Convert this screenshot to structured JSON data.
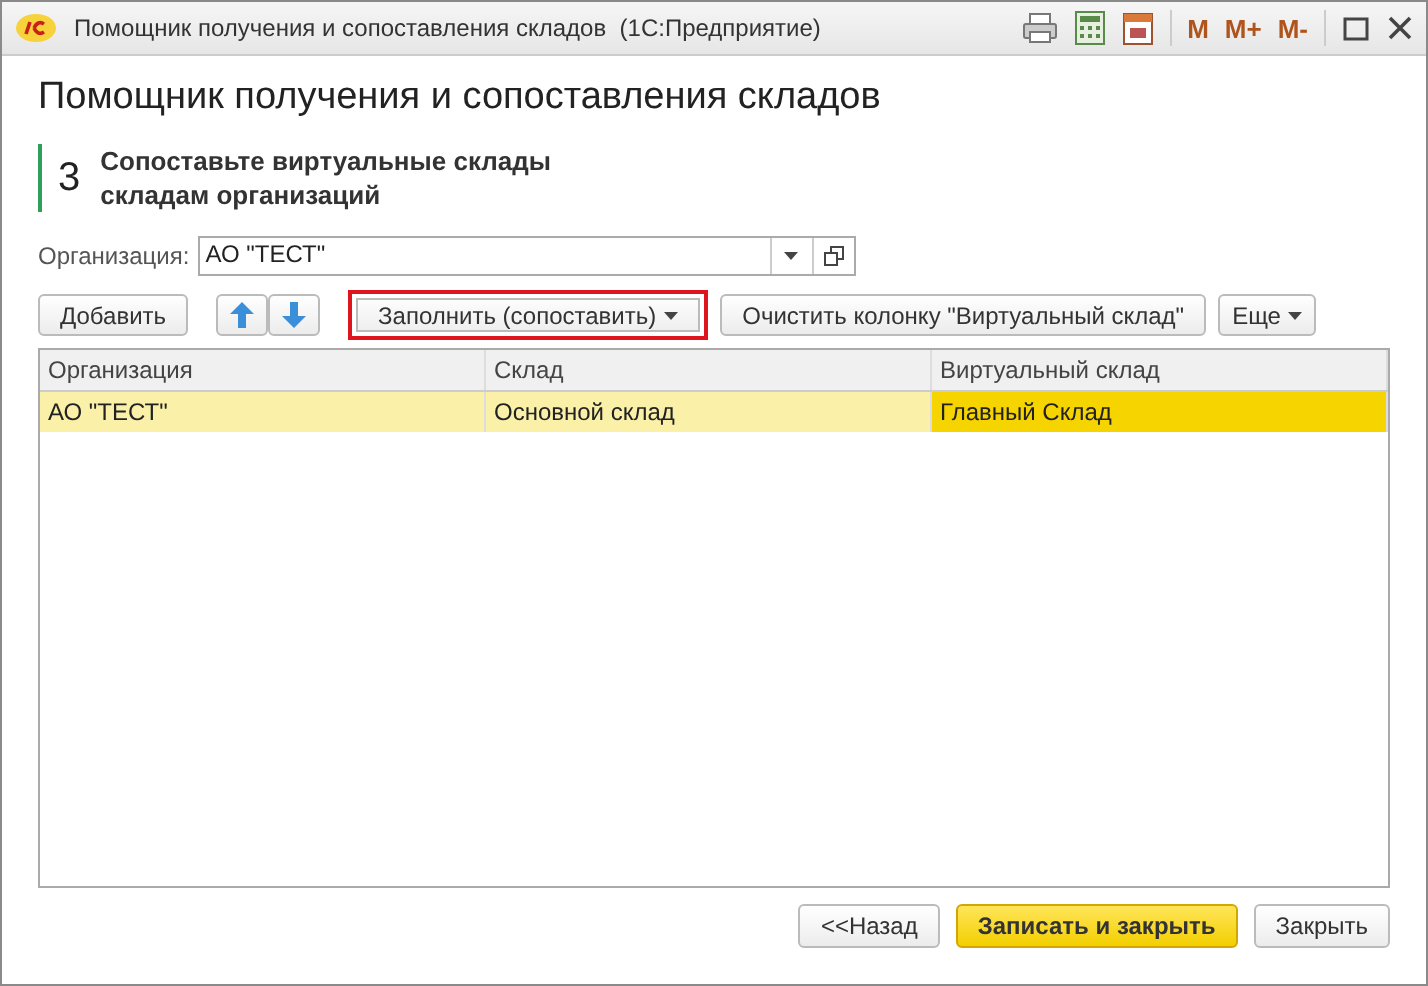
{
  "window": {
    "title": "Помощник получения и сопоставления складов  (1С:Предприятие)",
    "memory_buttons": [
      "M",
      "M+",
      "M-"
    ]
  },
  "heading": "Помощник получения и сопоставления складов",
  "step": {
    "number": "3",
    "text": "Сопоставьте виртуальные склады\nскладам организаций"
  },
  "organization_field": {
    "label": "Организация:",
    "value": "АО \"ТЕСТ\""
  },
  "toolbar": [
    {
      "kind": "button",
      "label": "Добавить",
      "highlighted": false
    },
    {
      "kind": "arrows"
    },
    {
      "kind": "dropdown",
      "label": "Заполнить (сопоставить)",
      "highlighted": true
    },
    {
      "kind": "button",
      "label": "Очистить колонку \"Виртуальный склад\"",
      "highlighted": false
    },
    {
      "kind": "more",
      "label": "Еще",
      "highlighted": false
    }
  ],
  "table": {
    "columns": [
      "Организация",
      "Склад",
      "Виртуальный склад"
    ],
    "rows": [
      {
        "selected": true,
        "cells": [
          {
            "text": "АО \"ТЕСТ\"",
            "current": false
          },
          {
            "text": "Основной склад",
            "current": false
          },
          {
            "text": "Главный Склад",
            "current": true
          }
        ]
      }
    ]
  },
  "footer_buttons": [
    {
      "label": "<<Назад",
      "primary": false
    },
    {
      "label": "Записать и закрыть",
      "primary": true
    },
    {
      "label": "Закрыть",
      "primary": false
    }
  ]
}
